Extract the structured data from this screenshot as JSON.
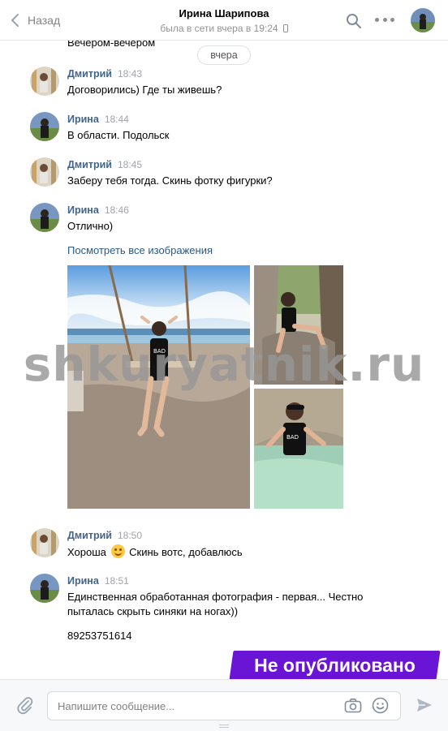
{
  "header": {
    "back_label": "Назад",
    "peer_name": "Ирина Шарипова",
    "peer_status": "была в сети вчера в 19:24"
  },
  "history": {
    "previous_text": "Вечером-вечером",
    "date_divider": "вчера",
    "messages": [
      {
        "author": "Дмитрий",
        "time": "18:43",
        "text": "Договорились) Где ты живешь?"
      },
      {
        "author": "Ирина",
        "time": "18:44",
        "text": "В области. Подольск"
      },
      {
        "author": "Дмитрий",
        "time": "18:45",
        "text": "Заберу тебя тогда. Скинь фотку фигурки?"
      },
      {
        "author": "Ирина",
        "time": "18:46",
        "text": "Отлично)"
      },
      {
        "author": "Дмитрий",
        "time": "18:50",
        "text_before": "Хороша",
        "text_after": "Скинь вотс, добавлюсь"
      },
      {
        "author": "Ирина",
        "time": "18:51",
        "text": "Единственная обработанная фотография - первая... Честно пыталась скрыть синяки на ногах))",
        "extra": "89253751614"
      }
    ],
    "attachments": {
      "see_all_label": "Посмотреть все изображения",
      "photo_text": "BAD"
    }
  },
  "overlays": {
    "watermark": "shkuryatnik.ru",
    "unpublished_badge": "Не опубликовано"
  },
  "composer": {
    "placeholder": "Напишите сообщение..."
  },
  "colors": {
    "link": "#2a5885",
    "author": "#42648b",
    "badge": "#6a14d6"
  }
}
